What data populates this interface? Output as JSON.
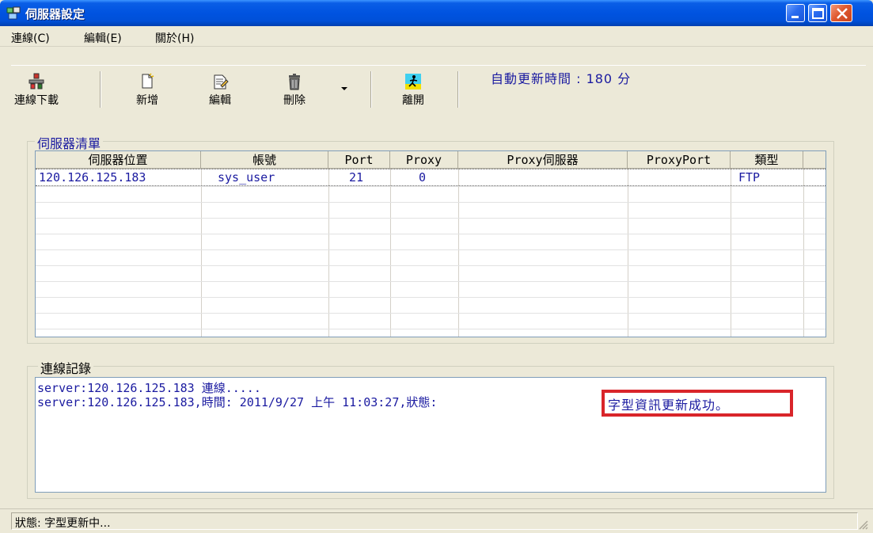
{
  "window": {
    "title": "伺服器設定"
  },
  "menu": [
    "連線(C)",
    "編輯(E)",
    "關於(H)"
  ],
  "toolbar": {
    "connect_download": "連線下載",
    "add": "新增",
    "edit": "編輯",
    "delete": "刪除",
    "exit": "離開",
    "auto_update": "自動更新時間 : 180 分"
  },
  "server_list": {
    "title": "伺服器清單",
    "columns": [
      "伺服器位置",
      "帳號",
      "Port",
      "Proxy",
      "Proxy伺服器",
      "ProxyPort",
      "類型"
    ],
    "rows": [
      {
        "host": "120.126.125.183",
        "account": "sys_user",
        "port": "21",
        "proxy": "0",
        "proxy_server": "",
        "proxy_port": "",
        "type": "FTP"
      }
    ]
  },
  "log": {
    "title": "連線記錄",
    "lines": [
      "server:120.126.125.183 連線.....",
      "server:120.126.125.183,時間: 2011/9/27 上午 11:03:27,狀態:"
    ],
    "highlight": "字型資訊更新成功。"
  },
  "status": {
    "text": "狀態: 字型更新中..."
  },
  "colors": {
    "title_bar": "#0053e0",
    "text_blue": "#1a1aa0",
    "highlight_border": "#d9252a",
    "face": "#ece9d8"
  }
}
